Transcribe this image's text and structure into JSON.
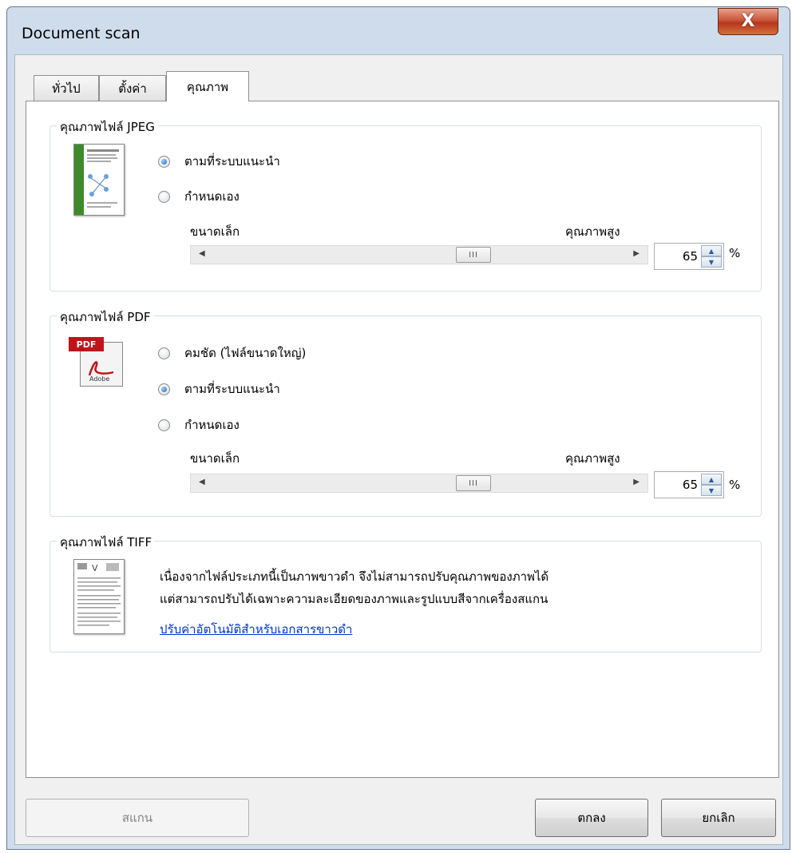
{
  "window": {
    "title": "Document scan",
    "close_glyph": "X"
  },
  "tabs": [
    {
      "label": "ทั่วไป"
    },
    {
      "label": "ตั้งค่า"
    },
    {
      "label": "คุณภาพ"
    }
  ],
  "jpeg": {
    "title": "คุณภาพไฟล์ JPEG",
    "options": [
      {
        "label": "ตามที่ระบบแนะนำ",
        "checked": true
      },
      {
        "label": "กำหนดเอง",
        "checked": false
      }
    ],
    "slider_min_label": "ขนาดเล็ก",
    "slider_max_label": "คุณภาพสูง",
    "slider_level": 0.58,
    "value": "65",
    "unit": "%"
  },
  "pdf": {
    "title": "คุณภาพไฟล์ PDF",
    "icon_label": "PDF",
    "icon_brand": "Adobe",
    "options": [
      {
        "label": "คมชัด (ไฟล์ขนาดใหญ่)",
        "checked": false
      },
      {
        "label": "ตามที่ระบบแนะนำ",
        "checked": true
      },
      {
        "label": "กำหนดเอง",
        "checked": false
      }
    ],
    "slider_min_label": "ขนาดเล็ก",
    "slider_max_label": "คุณภาพสูง",
    "slider_level": 0.58,
    "value": "65",
    "unit": "%"
  },
  "tiff": {
    "title": "คุณภาพไฟล์ TIFF",
    "description_line1": "เนื่องจากไฟล์ประเภทนี้เป็นภาพขาวดำ จึงไม่สามารถปรับคุณภาพของภาพได้",
    "description_line2": "แต่สามารถปรับได้เฉพาะความละเอียดของภาพและรูปแบบสีจากเครื่องสแกน",
    "link": "ปรับค่าอัตโนมัติสำหรับเอกสารขาวดำ"
  },
  "buttons": {
    "scan": "สแกน",
    "ok": "ตกลง",
    "cancel": "ยกเลิก"
  },
  "slider_thumb_glyph": "III",
  "colors": {
    "accent": "#1a5fb4",
    "link": "#0033cc",
    "close": "#c9553a"
  }
}
